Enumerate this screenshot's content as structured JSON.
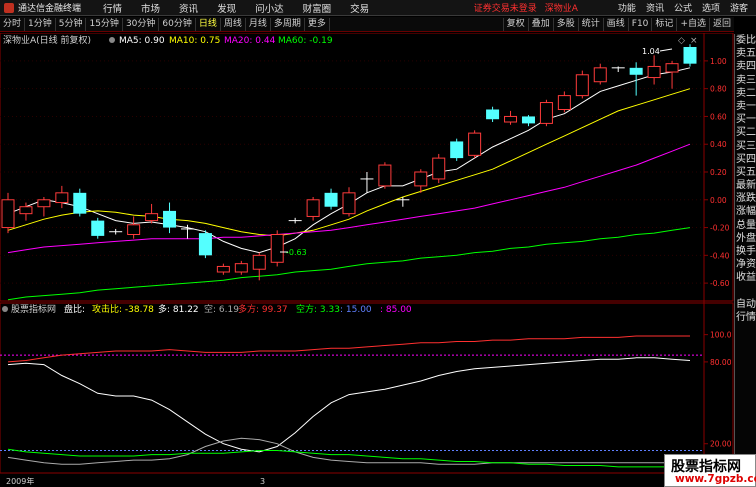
{
  "menubar": {
    "app_title": "通达信金融终端",
    "items": [
      "行情",
      "市场",
      "资讯",
      "发现",
      "问小达",
      "财富圈",
      "交易"
    ],
    "login_status": "证券交易未登录",
    "stock_name": "深物业A",
    "right_items": [
      "功能",
      "资讯",
      "公式",
      "选项"
    ],
    "guest": "游客"
  },
  "toolbar": {
    "periods": [
      "分时",
      "1分钟",
      "5分钟",
      "15分钟",
      "30分钟",
      "60分钟",
      "日线",
      "周线",
      "月线",
      "多周期",
      "更多"
    ],
    "active_period": "日线",
    "tools": [
      "复权",
      "叠加",
      "多股",
      "统计",
      "画线",
      "F10",
      "标记",
      "+自选",
      "返回"
    ]
  },
  "main_chart": {
    "title": "深物业A(日线 前复权)",
    "ma_legend": [
      {
        "label": "MA5: 0.90",
        "color": "#ffffff"
      },
      {
        "label": "MA10: 0.75",
        "color": "#ffff00"
      },
      {
        "label": "MA20: 0.44",
        "color": "#ff00ff"
      },
      {
        "label": "MA60: -0.19",
        "color": "#00ff00"
      }
    ],
    "y_ticks": [
      "1.00",
      "0.80",
      "0.60",
      "0.40",
      "0.20",
      "0.00",
      "-0.20",
      "-0.40",
      "-0.60"
    ],
    "high_label": "1.04",
    "low_label": "-0.63"
  },
  "indicator": {
    "name": "股票指标网",
    "legend": [
      {
        "label": "盘比:",
        "color": "#ffffff"
      },
      {
        "label": "攻击比: -38.78",
        "color": "#ffff00"
      },
      {
        "label": "多: 81.22",
        "color": "#ffffff"
      },
      {
        "label": "空: 6.19",
        "color": "#aaaaaa"
      },
      {
        "label": "多方: 99.37",
        "color": "#ff3030"
      },
      {
        "label": "空方: 3.33",
        "color": "#00ff00"
      },
      {
        "label": ": 15.00",
        "color": "#6080ff"
      },
      {
        "label": ": 85.00",
        "color": "#ff00ff"
      }
    ],
    "y_ticks": [
      "100.0",
      "80.00",
      "20.00"
    ]
  },
  "xaxis": {
    "labels": [
      "2009年",
      "3"
    ]
  },
  "side_panel": {
    "tabs": [
      "委比",
      "卖五",
      "卖四",
      "卖三",
      "卖二",
      "卖一",
      "买一",
      "买二",
      "买三",
      "买四",
      "买五",
      "最新",
      "涨跌",
      "涨幅",
      "总量",
      "外盘",
      "换手",
      "净资",
      "收益",
      "",
      "自动",
      "行情"
    ]
  },
  "watermark": {
    "title": "股票指标网",
    "url": "www.7gpzb.com"
  },
  "chart_data": {
    "type": "candlestick",
    "ylim": [
      -0.7,
      1.1
    ],
    "candles": [
      [
        0.0,
        -0.2,
        0.05,
        -0.24,
        "up"
      ],
      [
        -0.1,
        -0.05,
        -0.02,
        -0.15,
        "up"
      ],
      [
        -0.05,
        0.0,
        0.02,
        -0.12,
        "up"
      ],
      [
        -0.02,
        0.05,
        0.1,
        -0.06,
        "up"
      ],
      [
        0.05,
        -0.1,
        0.08,
        -0.12,
        "down"
      ],
      [
        -0.15,
        -0.26,
        -0.13,
        -0.28,
        "down"
      ],
      [
        -0.23,
        -0.23,
        -0.21,
        -0.25,
        "flat"
      ],
      [
        -0.25,
        -0.18,
        -0.12,
        -0.28,
        "up"
      ],
      [
        -0.15,
        -0.1,
        -0.03,
        -0.17,
        "up"
      ],
      [
        -0.08,
        -0.2,
        -0.02,
        -0.24,
        "down"
      ],
      [
        -0.21,
        -0.21,
        -0.18,
        -0.28,
        "flat"
      ],
      [
        -0.24,
        -0.4,
        -0.22,
        -0.42,
        "down"
      ],
      [
        -0.48,
        -0.52,
        -0.46,
        -0.54,
        "up"
      ],
      [
        -0.52,
        -0.46,
        -0.44,
        -0.54,
        "up"
      ],
      [
        -0.5,
        -0.4,
        -0.38,
        -0.58,
        "up"
      ],
      [
        -0.45,
        -0.25,
        -0.22,
        -0.48,
        "up"
      ],
      [
        -0.15,
        -0.15,
        -0.13,
        -0.17,
        "flat"
      ],
      [
        -0.12,
        0.0,
        0.02,
        -0.15,
        "up"
      ],
      [
        0.05,
        -0.05,
        0.08,
        -0.07,
        "down"
      ],
      [
        -0.1,
        0.05,
        0.09,
        -0.12,
        "up"
      ],
      [
        0.15,
        0.15,
        0.2,
        0.05,
        "flat"
      ],
      [
        0.1,
        0.25,
        0.27,
        0.08,
        "up"
      ],
      [
        0.0,
        0.0,
        0.02,
        -0.05,
        "flat"
      ],
      [
        0.1,
        0.2,
        0.22,
        0.05,
        "up"
      ],
      [
        0.15,
        0.3,
        0.33,
        0.12,
        "up"
      ],
      [
        0.42,
        0.3,
        0.44,
        0.28,
        "down"
      ],
      [
        0.32,
        0.48,
        0.5,
        0.3,
        "up"
      ],
      [
        0.65,
        0.58,
        0.67,
        0.56,
        "down"
      ],
      [
        0.56,
        0.6,
        0.64,
        0.54,
        "up"
      ],
      [
        0.6,
        0.55,
        0.61,
        0.53,
        "down"
      ],
      [
        0.55,
        0.7,
        0.72,
        0.53,
        "up"
      ],
      [
        0.65,
        0.75,
        0.78,
        0.63,
        "up"
      ],
      [
        0.75,
        0.9,
        0.93,
        0.73,
        "up"
      ],
      [
        0.85,
        0.95,
        0.98,
        0.83,
        "up"
      ],
      [
        0.92,
        0.95,
        0.96,
        0.92,
        "flat"
      ],
      [
        0.95,
        0.9,
        0.99,
        0.75,
        "down"
      ],
      [
        0.88,
        0.96,
        1.04,
        0.83,
        "up"
      ],
      [
        0.92,
        0.98,
        1.0,
        0.8,
        "up"
      ],
      [
        0.98,
        1.1,
        1.12,
        0.96,
        "down"
      ]
    ],
    "series": [
      {
        "name": "MA5",
        "color": "#ffffff",
        "values": [
          -0.1,
          -0.05,
          0.0,
          -0.02,
          -0.05,
          -0.1,
          -0.15,
          -0.17,
          -0.16,
          -0.18,
          -0.2,
          -0.23,
          -0.3,
          -0.35,
          -0.38,
          -0.34,
          -0.28,
          -0.18,
          -0.1,
          -0.03,
          0.05,
          0.1,
          0.1,
          0.15,
          0.2,
          0.22,
          0.3,
          0.38,
          0.44,
          0.5,
          0.58,
          0.62,
          0.7,
          0.78,
          0.82,
          0.86,
          0.9,
          0.92,
          0.95
        ]
      },
      {
        "name": "MA10",
        "color": "#ffff00",
        "values": [
          -0.22,
          -0.18,
          -0.14,
          -0.11,
          -0.09,
          -0.08,
          -0.09,
          -0.11,
          -0.12,
          -0.14,
          -0.15,
          -0.17,
          -0.2,
          -0.23,
          -0.25,
          -0.26,
          -0.24,
          -0.22,
          -0.18,
          -0.14,
          -0.08,
          -0.03,
          0.02,
          0.06,
          0.1,
          0.14,
          0.18,
          0.22,
          0.28,
          0.34,
          0.4,
          0.46,
          0.52,
          0.58,
          0.64,
          0.68,
          0.72,
          0.76,
          0.8
        ]
      },
      {
        "name": "MA20",
        "color": "#ff00ff",
        "values": [
          -0.38,
          -0.36,
          -0.34,
          -0.33,
          -0.32,
          -0.31,
          -0.3,
          -0.29,
          -0.28,
          -0.28,
          -0.28,
          -0.28,
          -0.27,
          -0.27,
          -0.26,
          -0.25,
          -0.24,
          -0.23,
          -0.22,
          -0.2,
          -0.18,
          -0.16,
          -0.14,
          -0.12,
          -0.1,
          -0.08,
          -0.06,
          -0.03,
          0.0,
          0.03,
          0.06,
          0.09,
          0.13,
          0.17,
          0.21,
          0.25,
          0.3,
          0.35,
          0.4
        ]
      },
      {
        "name": "MA60",
        "color": "#00ff00",
        "values": [
          -0.72,
          -0.7,
          -0.69,
          -0.68,
          -0.67,
          -0.65,
          -0.64,
          -0.63,
          -0.62,
          -0.61,
          -0.6,
          -0.59,
          -0.58,
          -0.56,
          -0.55,
          -0.54,
          -0.52,
          -0.51,
          -0.5,
          -0.48,
          -0.46,
          -0.45,
          -0.44,
          -0.42,
          -0.41,
          -0.4,
          -0.38,
          -0.37,
          -0.35,
          -0.34,
          -0.32,
          -0.31,
          -0.3,
          -0.28,
          -0.27,
          -0.25,
          -0.24,
          -0.22,
          -0.2
        ]
      }
    ],
    "indicator_ylim": [
      0,
      110
    ],
    "indicator_series": [
      {
        "name": "多方",
        "color": "#ff3030",
        "values": [
          80,
          81,
          83,
          85,
          86,
          87,
          88,
          88,
          88,
          89,
          88,
          87,
          87,
          87,
          88,
          88,
          88,
          89,
          90,
          90,
          91,
          92,
          93,
          94,
          94,
          95,
          95,
          96,
          96,
          97,
          97,
          97,
          98,
          98,
          98,
          99,
          99,
          99,
          99
        ]
      },
      {
        "name": "多",
        "color": "#ffffff",
        "values": [
          78,
          79,
          78,
          70,
          64,
          57,
          55,
          55,
          52,
          45,
          36,
          27,
          20,
          16,
          14,
          18,
          28,
          40,
          50,
          56,
          58,
          60,
          63,
          66,
          70,
          73,
          75,
          76,
          77,
          78,
          79,
          80,
          81,
          82,
          82,
          83,
          83,
          82,
          81
        ]
      },
      {
        "name": "空",
        "color": "#aaaaaa",
        "values": [
          10,
          8,
          6,
          5,
          5,
          6,
          7,
          8,
          8,
          9,
          12,
          18,
          22,
          24,
          23,
          20,
          14,
          10,
          8,
          7,
          6,
          6,
          6,
          6,
          5,
          5,
          5,
          6,
          6,
          6,
          6,
          6,
          6,
          6,
          6,
          6,
          6,
          6,
          6
        ]
      },
      {
        "name": "空方",
        "color": "#00ff00",
        "values": [
          16,
          14,
          13,
          12,
          11,
          11,
          11,
          11,
          12,
          12,
          13,
          13,
          13,
          14,
          15,
          15,
          14,
          13,
          12,
          12,
          11,
          10,
          9,
          9,
          8,
          7,
          7,
          6,
          6,
          5,
          5,
          4,
          4,
          4,
          3,
          3,
          3,
          3,
          3
        ]
      }
    ]
  }
}
